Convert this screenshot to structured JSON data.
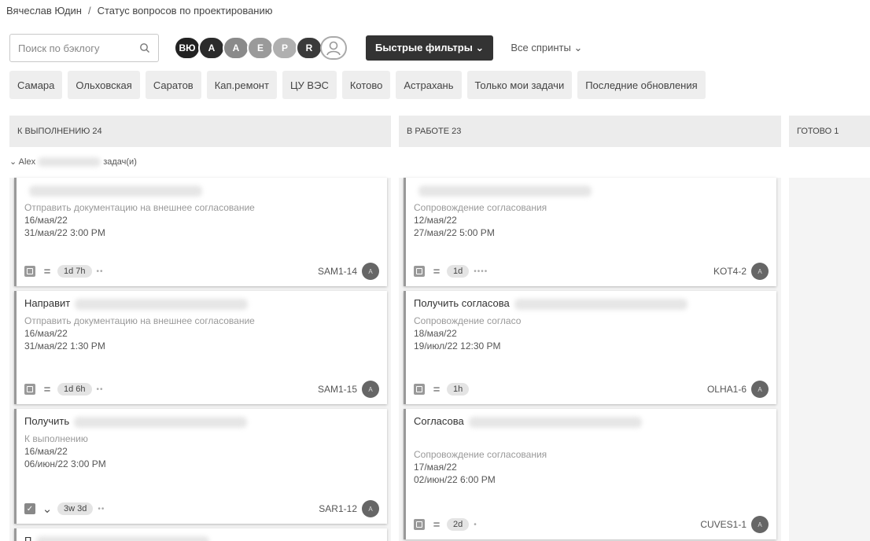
{
  "breadcrumb": {
    "user": "Вячеслав Юдин",
    "separator": "/",
    "page": "Статус вопросов по проектированию"
  },
  "toolbar": {
    "search_placeholder": "Поиск по бэклогу",
    "avatars": [
      {
        "label": "ВЮ",
        "color": "#222222"
      },
      {
        "label": "A",
        "color": "#2b2b2b"
      },
      {
        "label": "A",
        "color": "#8a8a8a"
      },
      {
        "label": "E",
        "color": "#9a9a9a"
      },
      {
        "label": "P",
        "color": "#b0b0b0"
      },
      {
        "label": "R",
        "color": "#3a3a3a"
      },
      {
        "label": "",
        "color": "#ffffff"
      }
    ],
    "quick_filters": "Быстрые фильтры ⌄",
    "sprints": "Все спринты ⌄"
  },
  "filter_chips": [
    "Самара",
    "Ольховская",
    "Саратов",
    "Кап.ремонт",
    "ЦУ ВЭС",
    "Котово",
    "Астрахань",
    "Только мои задачи",
    "Последние обновления"
  ],
  "columns": [
    {
      "title": "К ВЫПОЛНЕНИЮ 24"
    },
    {
      "title": "В РАБОТЕ 23"
    },
    {
      "title": "ГОТОВО 1"
    }
  ],
  "swimlane": {
    "toggle": "⌄",
    "name": "Alex",
    "suffix": "задач(и)"
  },
  "cards_todo": [
    {
      "title": "",
      "subtitle": "Отправить документацию на внешнее согласование",
      "date1": "16/мая/22",
      "date2": "31/мая/22 3:00 PM",
      "estimate": "1d 7h",
      "dots": "••",
      "key": "SAM1-14",
      "avatar": "A",
      "type": "task"
    },
    {
      "title": "Направит",
      "subtitle": "Отправить документацию на внешнее согласование",
      "date1": "16/мая/22",
      "date2": "31/мая/22 1:30 PM",
      "estimate": "1d 6h",
      "dots": "••",
      "key": "SAM1-15",
      "avatar": "A",
      "type": "task"
    },
    {
      "title": "Получить",
      "subtitle": "К выполнению",
      "date1": "16/мая/22",
      "date2": "06/июн/22 3:00 PM",
      "estimate": "3w 3d",
      "dots": "••",
      "key": "SAR1-12",
      "avatar": "A",
      "type": "check"
    },
    {
      "title": "П",
      "subtitle": "",
      "date1": "",
      "date2": "",
      "estimate": "",
      "dots": "",
      "key": "",
      "avatar": "",
      "type": "partial"
    }
  ],
  "cards_inprogress": [
    {
      "title": "",
      "subtitle": "Сопровождение согласования",
      "date1": "12/мая/22",
      "date2": "27/мая/22 5:00 PM",
      "estimate": "1d",
      "dots": "••••",
      "key": "KOT4-2",
      "avatar": "A",
      "type": "task"
    },
    {
      "title": "Получить согласова",
      "subtitle": "Сопровождение согласо",
      "date1": "18/мая/22",
      "date2": "19/июл/22 12:30 PM",
      "estimate": "1h",
      "dots": "",
      "key": "OLHA1-6",
      "avatar": "A",
      "type": "task"
    },
    {
      "title": "Согласова",
      "subtitle": "Сопровождение согласования",
      "date1": "17/мая/22",
      "date2": "02/июн/22 6:00 PM",
      "estimate": "2d",
      "dots": "•",
      "key": "CUVES1-1",
      "avatar": "A",
      "type": "task"
    }
  ]
}
